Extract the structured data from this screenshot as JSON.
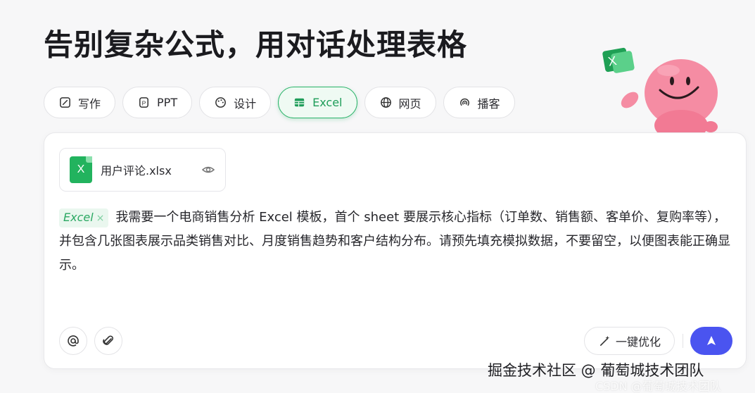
{
  "page_title": "告别复杂公式，用对话处理表格",
  "tabs": [
    {
      "label": "写作",
      "icon": "pen-icon"
    },
    {
      "label": "PPT",
      "icon": "ppt-icon"
    },
    {
      "label": "设计",
      "icon": "palette-icon"
    },
    {
      "label": "Excel",
      "icon": "table-icon",
      "active": true
    },
    {
      "label": "网页",
      "icon": "globe-icon"
    },
    {
      "label": "播客",
      "icon": "podcast-icon"
    }
  ],
  "attachment": {
    "file_name": "用户评论.xlsx",
    "icon_letter": "X"
  },
  "prompt": {
    "tag": "Excel",
    "tag_close": "×",
    "text": "我需要一个电商销售分析 Excel 模板，首个 sheet 要展示核心指标（订单数、销售额、客单价、复购率等），并包含几张图表展示品类销售对比、月度销售趋势和客户结构分布。请预先填充模拟数据，不要留空，以便图表能正确显示。"
  },
  "toolbar": {
    "optimize_label": "一键优化"
  },
  "watermark": {
    "primary": "掘金技术社区 @ 葡萄城技术团队",
    "secondary": "CSDN @葡萄城技术团队"
  },
  "colors": {
    "accent_green": "#2bb46a",
    "send_blue": "#4a54f0",
    "mascot_pink": "#f27a94"
  }
}
